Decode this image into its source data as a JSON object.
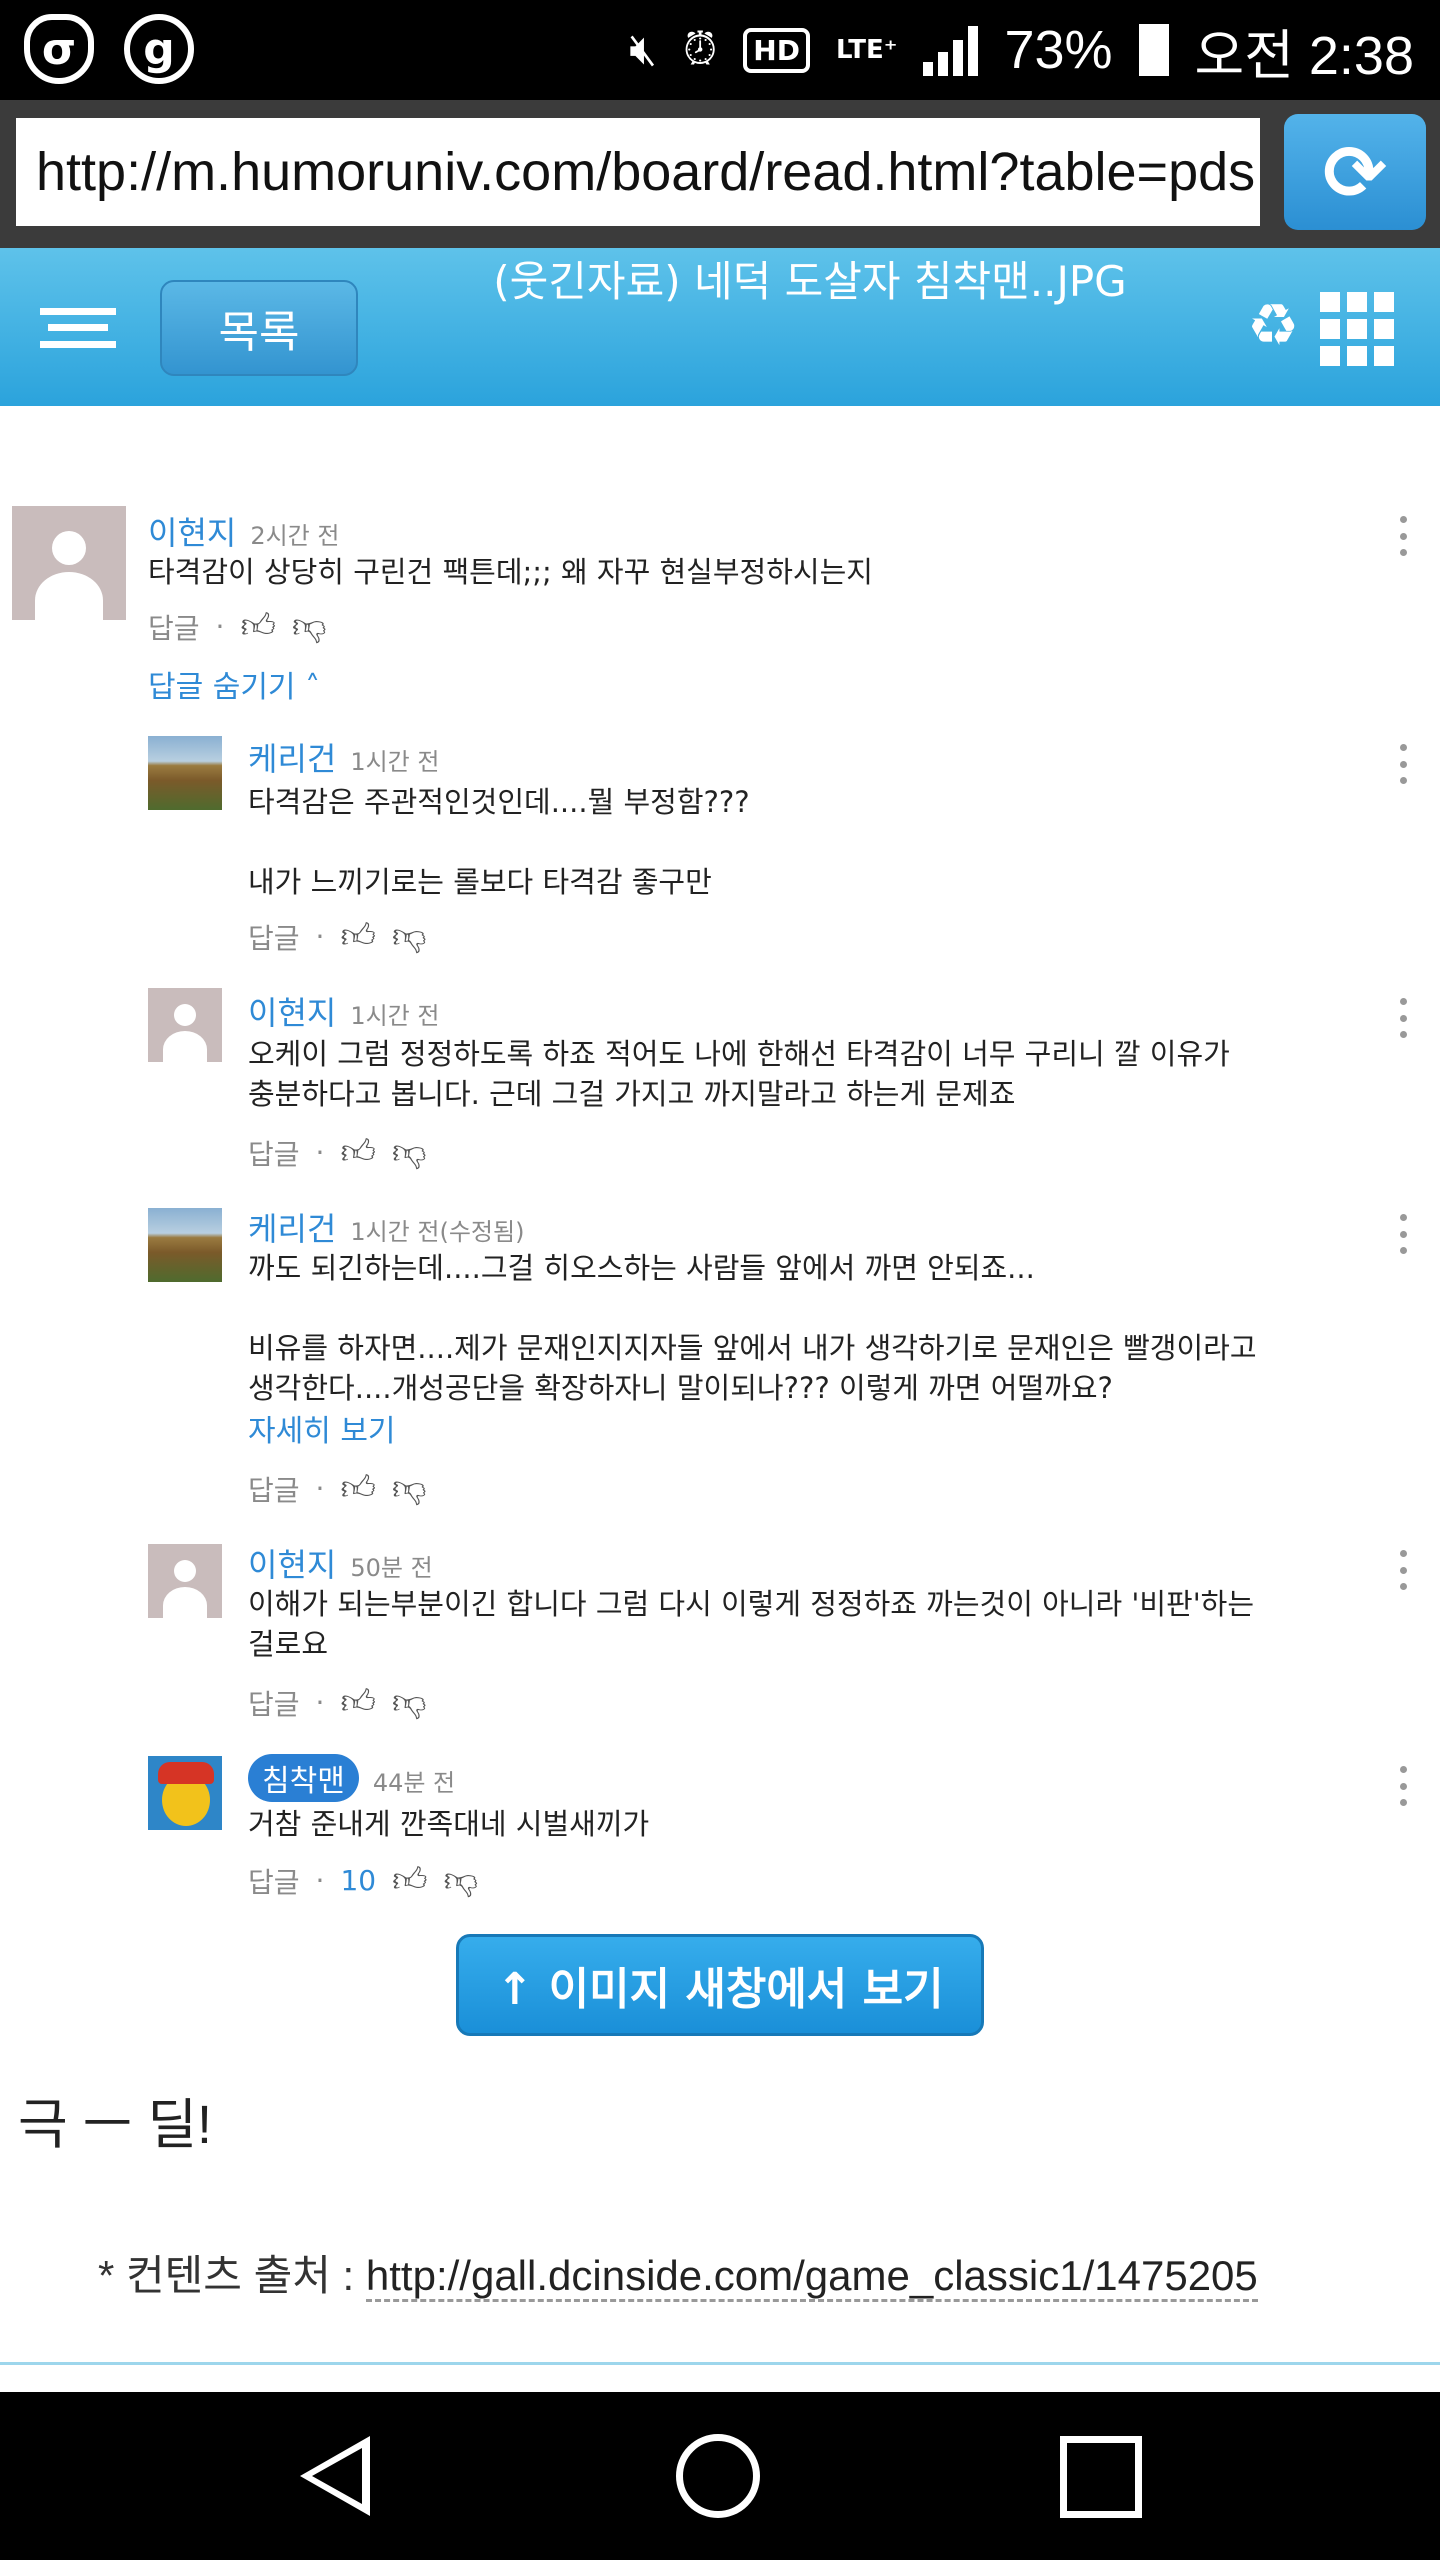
{
  "status_bar": {
    "app_icon_1": "σ",
    "app_icon_2": "g",
    "mute_icon": "mute-icon",
    "alarm_icon": "alarm-icon",
    "hd_label": "HD",
    "lte_label": "LTE⁺",
    "battery_percent": "73%",
    "time": "오전 2:38"
  },
  "browser": {
    "url": "http://m.humoruniv.com/board/read.html?table=pds"
  },
  "header": {
    "list_button": "목록",
    "title": "(웃긴자료) 네덕 도살자 침착맨..JPG"
  },
  "comments": {
    "top": {
      "author": "이현지",
      "time": "2시간 전",
      "text": "타격감이 상당히 구린건 팩튼데;;; 왜 자꾸 현실부정하시는지",
      "reply_label": "답글",
      "hide_replies": "답글 숨기기"
    },
    "replies": [
      {
        "author": "케리건",
        "time": "1시간 전",
        "text": "타격감은 주관적인것인데....뭘 부정함???\n\n내가 느끼기로는 롤보다 타격감 좋구만",
        "reply_label": "답글"
      },
      {
        "author": "이현지",
        "time": "1시간 전",
        "text": "오케이 그럼 정정하도록 하죠 적어도 나에 한해선 타격감이 너무 구리니 깔 이유가\n충분하다고 봅니다. 근데 그걸 가지고 까지말라고 하는게 문제죠",
        "reply_label": "답글"
      },
      {
        "author": "케리건",
        "time": "1시간 전(수정됨)",
        "text": "까도 되긴하는데....그걸 히오스하는 사람들 앞에서 까면 안되죠...\n\n비유를 하자면....제가 문재인지지자들 앞에서 내가 생각하기로 문재인은 빨갱이라고\n생각한다....개성공단을 확장하자니 말이되나??? 이렇게 까면 어떨까요?",
        "more_link": "자세히 보기",
        "reply_label": "답글"
      },
      {
        "author": "이현지",
        "time": "50분 전",
        "text": "이해가 되는부분이긴 합니다 그럼 다시 이렇게 정정하죠 까는것이 아니라 '비판'하는\n걸로요",
        "reply_label": "답글"
      },
      {
        "author": "침착맨",
        "time": "44분 전",
        "text": "거참 준내게 깐족대네 시벌새끼가",
        "reply_label": "답글",
        "likes": "10"
      }
    ]
  },
  "open_image_button": "↑ 이미지 새창에서 보기",
  "punchline": "극 ㅡ 딜!",
  "source": {
    "label": "* 컨텐츠 출처 :",
    "url": "http://gall.dcinside.com/game_classic1/1475205"
  }
}
